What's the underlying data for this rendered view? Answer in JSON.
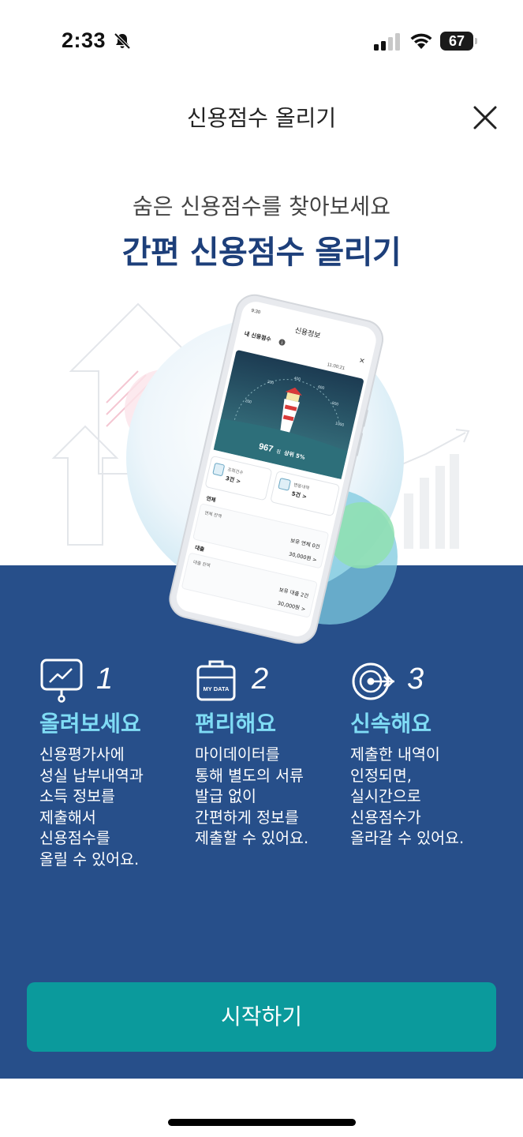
{
  "status_bar": {
    "time": "2:33",
    "battery": "67",
    "icons": [
      "bell-slash-icon",
      "signal-icon",
      "wifi-icon",
      "battery-icon"
    ]
  },
  "header": {
    "title": "신용점수 올리기",
    "close_icon": "close-icon"
  },
  "intro": {
    "subtitle": "숨은 신용점수를 찾아보세요",
    "title": "간편 신용점수 올리기"
  },
  "colors": {
    "title_blue": "#1d3f7a",
    "panel_blue": "#274f8a",
    "accent_cyan": "#7fdcf5",
    "button_teal": "#0b9a9c"
  },
  "phone_mock": {
    "status_time": "9:30",
    "screen_title": "신용정보",
    "my_score_label": "내 신용점수",
    "info_mark": "i",
    "close_mark": "✕",
    "updated_time": "11:00:21",
    "gauge_labels": [
      "300",
      "200",
      "400",
      "600",
      "800",
      "1000"
    ],
    "score": "967",
    "score_unit": "점",
    "score_rank": "상위 5%",
    "card_inquiry_label": "조회건수",
    "card_inquiry_value": "3건 >",
    "card_change_label": "변동내역",
    "card_change_value": "5건 >",
    "section_overdue": "연체",
    "overdue_label": "연체 잔액",
    "overdue_status": "보유 연체 0건",
    "overdue_amount": "30,000원 >",
    "section_loan": "대출",
    "loan_label": "대출 잔액",
    "loan_status": "보유 대출 2건",
    "loan_amount": "30,000원 >"
  },
  "features": [
    {
      "number": "1",
      "icon": "presentation-chart-icon",
      "title": "올려보세요",
      "desc": "신용평가사에\n성실 납부내역과\n소득 정보를\n제출해서\n신용점수를\n올릴 수 있어요."
    },
    {
      "number": "2",
      "icon": "my-data-briefcase-icon",
      "icon_text": "MY DATA",
      "title": "편리해요",
      "desc": "마이데이터를\n통해 별도의 서류\n발급 없이\n간편하게 정보를\n제출할 수 있어요."
    },
    {
      "number": "3",
      "icon": "target-arrow-icon",
      "title": "신속해요",
      "desc": "제출한 내역이\n인정되면,\n실시간으로\n신용점수가\n올라갈 수 있어요."
    }
  ],
  "cta": {
    "label": "시작하기"
  }
}
